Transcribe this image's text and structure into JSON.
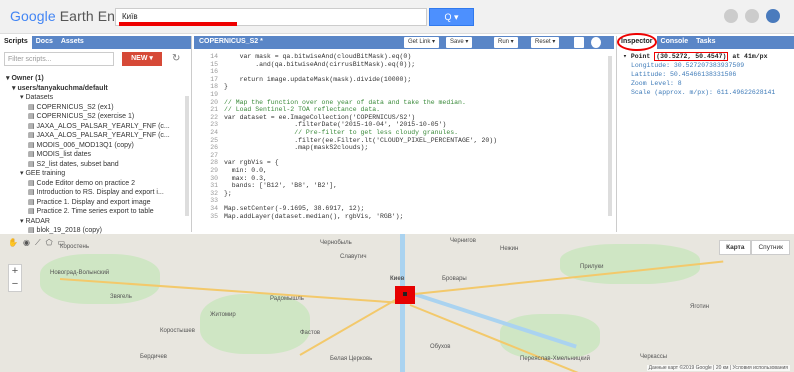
{
  "header": {
    "logo_google": "Google",
    "logo_rest": " Earth Engine",
    "search_value": "Київ",
    "search_button": "Q ▾"
  },
  "left_panel": {
    "tabs": [
      "Scripts",
      "Docs",
      "Assets"
    ],
    "filter_placeholder": "Filter scripts...",
    "new_button": "NEW ▾",
    "tree": [
      {
        "level": 1,
        "text": "▾ Owner (1)"
      },
      {
        "level": 2,
        "text": "▾ users/tanyakuchma/default"
      },
      {
        "level": 3,
        "text": "▾ Datasets"
      },
      {
        "level": 4,
        "text": "▤ COPERNICUS_S2 (ex1)"
      },
      {
        "level": 4,
        "text": "▤ COPERNICUS_S2 (exercise 1)"
      },
      {
        "level": 4,
        "text": "▤ JAXA_ALOS_PALSAR_YEARLY_FNF (c..."
      },
      {
        "level": 4,
        "text": "▤ JAXA_ALOS_PALSAR_YEARLY_FNF (c..."
      },
      {
        "level": 4,
        "text": "▤ MODIS_006_MOD13Q1 (copy)"
      },
      {
        "level": 4,
        "text": "▤ MODIS_list dates"
      },
      {
        "level": 4,
        "text": "▤ S2_list dates, subset band"
      },
      {
        "level": 3,
        "text": "▾ GEE training"
      },
      {
        "level": 4,
        "text": "▤ Code Editor demo on practice 2"
      },
      {
        "level": 4,
        "text": "▤ Introduction to RS. Display and export i..."
      },
      {
        "level": 4,
        "text": "▤ Practice 1. Display and export image"
      },
      {
        "level": 4,
        "text": "▤ Practice 2. Time series export to table"
      },
      {
        "level": 3,
        "text": "▾ RADAR"
      },
      {
        "level": 4,
        "text": "▤ blok_19_2018 (copy)"
      }
    ]
  },
  "code_panel": {
    "title": "COPERNICUS_S2 *",
    "buttons": [
      "Get Link ▾",
      "Save ▾",
      "Run ▾",
      "Reset ▾"
    ],
    "lines": [
      {
        "n": "14",
        "t": "    var mask = qa.bitwiseAnd(cloudBitMask).eq(0)"
      },
      {
        "n": "15",
        "t": "        .and(qa.bitwiseAnd(cirrusBitMask).eq(0));"
      },
      {
        "n": "16",
        "t": ""
      },
      {
        "n": "17",
        "t": "    return image.updateMask(mask).divide(10000);"
      },
      {
        "n": "18",
        "t": "}"
      },
      {
        "n": "19",
        "t": ""
      },
      {
        "n": "20",
        "t": "// Map the function over one year of data and take the median."
      },
      {
        "n": "21",
        "t": "// Load Sentinel-2 TOA reflectance data."
      },
      {
        "n": "22",
        "t": "var dataset = ee.ImageCollection('COPERNICUS/S2')"
      },
      {
        "n": "23",
        "t": "                  .filterDate('2015-10-04', '2015-10-05')"
      },
      {
        "n": "24",
        "t": "                  // Pre-filter to get less cloudy granules."
      },
      {
        "n": "25",
        "t": "                  .filter(ee.Filter.lt('CLOUDY_PIXEL_PERCENTAGE', 20))"
      },
      {
        "n": "26",
        "t": "                  .map(maskS2clouds);"
      },
      {
        "n": "27",
        "t": ""
      },
      {
        "n": "28",
        "t": "var rgbVis = {"
      },
      {
        "n": "29",
        "t": "  min: 0.0,"
      },
      {
        "n": "30",
        "t": "  max: 0.3,"
      },
      {
        "n": "31",
        "t": "  bands: ['B12', 'B8', 'B2'],"
      },
      {
        "n": "32",
        "t": "};"
      },
      {
        "n": "33",
        "t": ""
      },
      {
        "n": "34",
        "t": "Map.setCenter(-9.1695, 38.6917, 12);"
      },
      {
        "n": "35",
        "t": "Map.addLayer(dataset.median(), rgbVis, 'RGB');"
      }
    ]
  },
  "right_panel": {
    "tabs": [
      "Inspector",
      "Console",
      "Tasks"
    ],
    "point_label": "▾ Point",
    "point_coords": "(30.5272, 50.4547)",
    "point_suffix": "at 41m/px",
    "rows": [
      "Longitude: 30.527207383937509",
      "Latitude: 50.45466138331506",
      "Zoom Level: 8",
      "Scale (approx. m/px): 611.49622628141"
    ]
  },
  "map": {
    "type_buttons": [
      "Карта",
      "Спутник"
    ],
    "labels": [
      "Коростень",
      "Новоград-Волынский",
      "Радомышль",
      "Житомир",
      "Бердичев",
      "Бровары",
      "Прилуки",
      "Переяслав-Хмельницкий",
      "Белая Церковь",
      "Фастов",
      "Обухов",
      "Черкассы",
      "Нежин",
      "Чернигов",
      "Киев",
      "Славутич",
      "Коростышев",
      "Звягель",
      "Чернобыль",
      "Яготин"
    ],
    "attribution": "Данные карт ©2019 Google | 20 км | Условия использования"
  }
}
